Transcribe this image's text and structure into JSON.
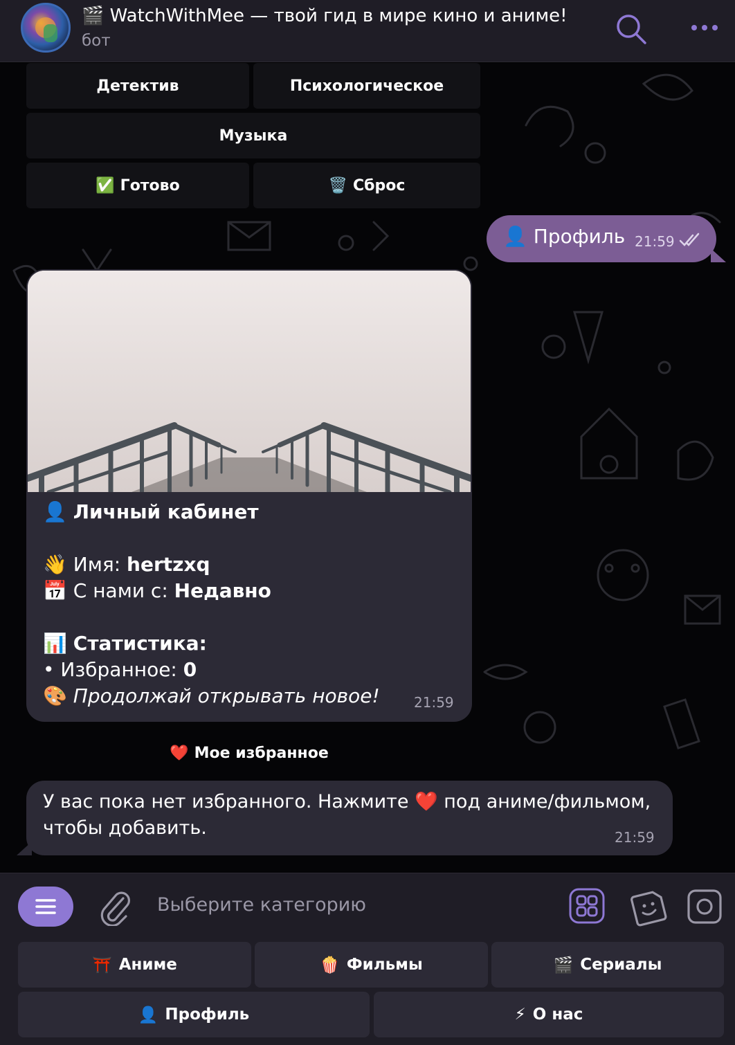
{
  "header": {
    "title": "🎬 WatchWithMee — твой гид в мире кино и аниме!",
    "subtitle": "бот"
  },
  "genre_keyboard": {
    "detective": "Детектив",
    "psychological": "Психологическое",
    "music": "Музыка",
    "done_emoji": "✅",
    "done": "Готово",
    "reset_emoji": "🗑️",
    "reset": "Сброс"
  },
  "outgoing": {
    "emoji": "👤",
    "text": "Профиль",
    "time": "21:59"
  },
  "profile_card": {
    "title_emoji": "👤",
    "title": "Личный кабинет",
    "name_emoji": "👋",
    "name_label": "Имя:",
    "name_value": "hertzxq",
    "since_emoji": "📅",
    "since_label": "С нами с:",
    "since_value": "Недавно",
    "stats_emoji": "📊",
    "stats_title": "Статистика:",
    "fav_label": "• Избранное:",
    "fav_value": "0",
    "footer_emoji": "🎨",
    "footer": "Продолжай открывать новое!",
    "time": "21:59"
  },
  "favorites_button": {
    "emoji": "❤️",
    "label": "Мое избранное"
  },
  "incoming": {
    "text_before": "У вас пока нет избранного. Нажмите",
    "emoji": "❤️",
    "text_after": "под аниме/фильмом, чтобы добавить.",
    "time": "21:59"
  },
  "input": {
    "placeholder": "Выберите категорию"
  },
  "reply_keyboard": {
    "anime_emoji": "⛩️",
    "anime": "Аниме",
    "films_emoji": "🍿",
    "films": "Фильмы",
    "series_emoji": "🎬",
    "series": "Сериалы",
    "profile_emoji": "👤",
    "profile": "Профиль",
    "about_emoji": "⚡",
    "about": "О нас"
  },
  "colors": {
    "accent": "#8e78d4",
    "outgoing_bubble": "#7c5d95",
    "incoming_bubble": "#2c2a36",
    "header_bg": "#1f1d26"
  }
}
